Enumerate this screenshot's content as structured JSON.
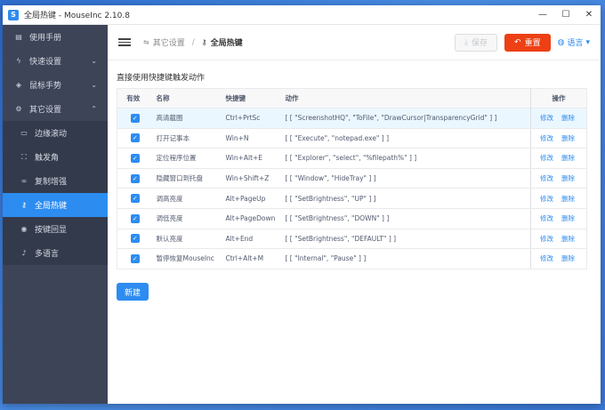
{
  "window": {
    "title": "全局热键 - MouseInc 2.10.8",
    "icon_letter": "S"
  },
  "sidebar": {
    "items": [
      {
        "label": "使用手册",
        "icon": "book-icon"
      },
      {
        "label": "快速设置",
        "icon": "lightning-icon"
      },
      {
        "label": "鼠标手势",
        "icon": "mouse-icon"
      },
      {
        "label": "其它设置",
        "icon": "gear-icon"
      }
    ],
    "subitems": [
      {
        "label": "边缘滚动",
        "icon": "monitor-icon"
      },
      {
        "label": "触发角",
        "icon": "corner-icon"
      },
      {
        "label": "复制增强",
        "icon": "link-icon"
      },
      {
        "label": "全局热键",
        "icon": "key-icon"
      },
      {
        "label": "按键回显",
        "icon": "eye-icon"
      },
      {
        "label": "多语言",
        "icon": "mic-icon"
      }
    ]
  },
  "header": {
    "breadcrumb_parent": "其它设置",
    "breadcrumb_current": "全局热键",
    "save_label": "保存",
    "reset_label": "重置",
    "lang_label": "语言"
  },
  "content": {
    "section_title": "直接使用快捷键触发动作",
    "columns": {
      "enabled": "有效",
      "name": "名称",
      "hotkey": "快捷键",
      "action": "动作",
      "ops": "操作"
    },
    "edit_label": "修改",
    "delete_label": "删除",
    "rows": [
      {
        "name": "高清截图",
        "hotkey": "Ctrl+PrtSc",
        "action": "[ [ \"ScreenshotHQ\", \"ToFile\", \"DrawCursor|TransparencyGrid\" ] ]"
      },
      {
        "name": "打开记事本",
        "hotkey": "Win+N",
        "action": "[ [ \"Execute\", \"notepad.exe\" ] ]"
      },
      {
        "name": "定位程序位置",
        "hotkey": "Win+Alt+E",
        "action": "[ [ \"Explorer\", \"select\", \"%filepath%\" ] ]"
      },
      {
        "name": "隐藏窗口到托盘",
        "hotkey": "Win+Shift+Z",
        "action": "[ [ \"Window\", \"HideTray\" ] ]"
      },
      {
        "name": "调高亮度",
        "hotkey": "Alt+PageUp",
        "action": "[ [ \"SetBrightness\", \"UP\" ] ]"
      },
      {
        "name": "调低亮度",
        "hotkey": "Alt+PageDown",
        "action": "[ [ \"SetBrightness\", \"DOWN\" ] ]"
      },
      {
        "name": "默认亮度",
        "hotkey": "Alt+End",
        "action": "[ [ \"SetBrightness\", \"DEFAULT\" ] ]"
      },
      {
        "name": "暂停恢复MouseInc",
        "hotkey": "Ctrl+Alt+M",
        "action": "[ [ \"Internal\", \"Pause\" ] ]"
      }
    ],
    "new_label": "新建"
  }
}
